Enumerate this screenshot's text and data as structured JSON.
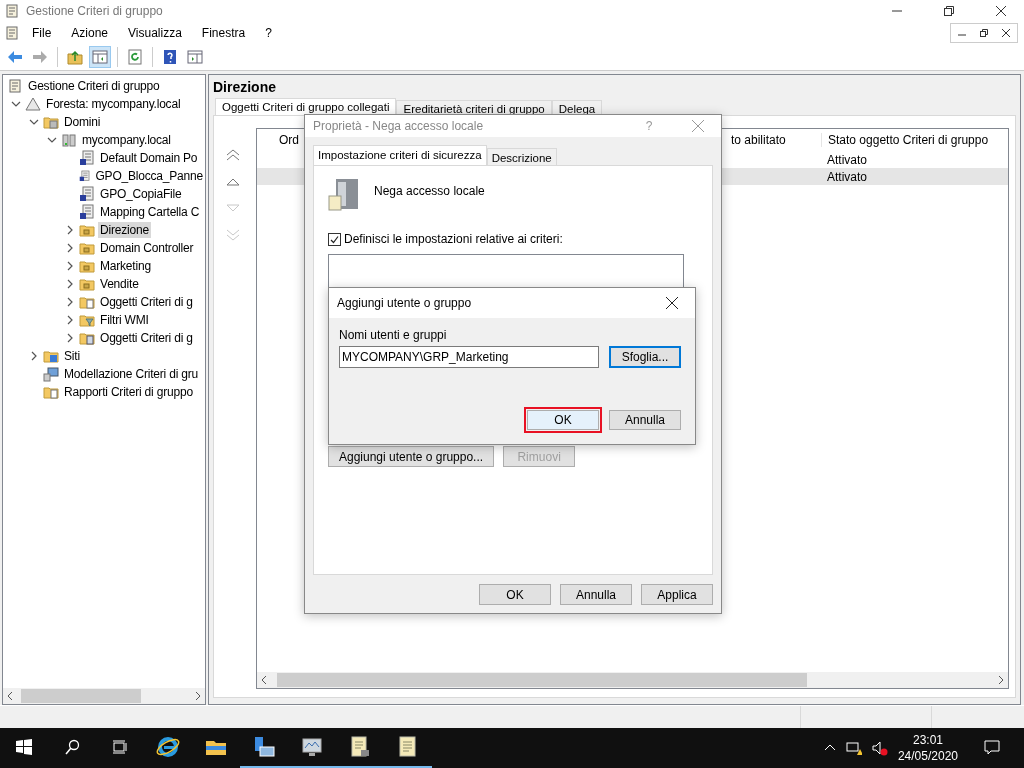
{
  "window": {
    "title": "Gestione Criteri di gruppo"
  },
  "menu": [
    "File",
    "Azione",
    "Visualizza",
    "Finestra",
    "?"
  ],
  "toolbar": [
    {
      "kind": "back",
      "disabled": false,
      "pressed": false
    },
    {
      "kind": "forward",
      "disabled": true,
      "pressed": false
    },
    {
      "kind": "up",
      "disabled": false,
      "pressed": false
    },
    {
      "kind": "pane",
      "disabled": false,
      "pressed": true
    },
    {
      "kind": "refresh",
      "disabled": false,
      "pressed": false
    },
    {
      "kind": "help",
      "disabled": false,
      "pressed": false
    },
    {
      "kind": "action-pane",
      "disabled": false,
      "pressed": false
    }
  ],
  "tree": [
    {
      "label": "Gestione Criteri di gruppo",
      "kind": "console",
      "selected": false,
      "children": [
        {
          "label": "Foresta: mycompany.local",
          "kind": "forest",
          "expanded": true,
          "selected": false,
          "children": [
            {
              "label": "Domini",
              "kind": "domains",
              "expanded": true,
              "selected": false,
              "children": [
                {
                  "label": "mycompany.local",
                  "kind": "domain",
                  "expanded": true,
                  "selected": false,
                  "children": [
                    {
                      "label": "Default Domain Po",
                      "kind": "gpo-link",
                      "selected": false
                    },
                    {
                      "label": "GPO_Blocca_Panne",
                      "kind": "gpo-link",
                      "selected": false
                    },
                    {
                      "label": "GPO_CopiaFile",
                      "kind": "gpo-link",
                      "selected": false
                    },
                    {
                      "label": "Mapping Cartella C",
                      "kind": "gpo-link",
                      "selected": false
                    },
                    {
                      "label": "Direzione",
                      "kind": "ou",
                      "expanded": false,
                      "selected": true
                    },
                    {
                      "label": "Domain Controller",
                      "kind": "ou",
                      "expanded": false,
                      "selected": false
                    },
                    {
                      "label": "Marketing",
                      "kind": "ou",
                      "expanded": false,
                      "selected": false
                    },
                    {
                      "label": "Vendite",
                      "kind": "ou",
                      "expanded": false,
                      "selected": false
                    },
                    {
                      "label": "Oggetti Criteri di g",
                      "kind": "gpo-folder",
                      "expanded": false,
                      "selected": false
                    },
                    {
                      "label": "Filtri WMI",
                      "kind": "wmi",
                      "expanded": false,
                      "selected": false
                    },
                    {
                      "label": "Oggetti Criteri di g",
                      "kind": "starter",
                      "expanded": false,
                      "selected": false
                    }
                  ]
                }
              ]
            },
            {
              "label": "Siti",
              "kind": "sites",
              "expanded": false,
              "selected": false
            },
            {
              "label": "Modellazione Criteri di gru",
              "kind": "modeling",
              "selected": false
            },
            {
              "label": "Rapporti Criteri di gruppo",
              "kind": "results",
              "selected": false
            }
          ]
        }
      ]
    }
  ],
  "details": {
    "title": "Direzione",
    "tabs": [
      {
        "label": "Oggetti Criteri di gruppo collegati",
        "selected": true
      },
      {
        "label": "Ereditarietà criteri di gruppo",
        "selected": false
      },
      {
        "label": "Delega",
        "selected": false
      }
    ],
    "order_buttons": [
      {
        "kind": "top",
        "disabled": false
      },
      {
        "kind": "up",
        "disabled": false
      },
      {
        "kind": "down",
        "disabled": true
      },
      {
        "kind": "bottom",
        "disabled": true
      }
    ],
    "table": {
      "columns": [
        "Ord",
        "to abilitato",
        "Stato oggetto Criteri di gruppo"
      ],
      "rows": [
        {
          "column_3": "Attivato",
          "selected": false
        },
        {
          "column_3": "Attivato",
          "selected": true
        }
      ]
    }
  },
  "properties_dialog": {
    "title": "Proprietà - Nega accesso locale",
    "help": "?",
    "tabs": [
      {
        "label": "Impostazione criteri di sicurezza",
        "selected": true
      },
      {
        "label": "Descrizione",
        "selected": false
      }
    ],
    "policy_name": "Nega accesso locale",
    "define": {
      "label": "Definisci le impostazioni relative ai criteri:",
      "checked": true
    },
    "list_buttons": [
      {
        "label": "Aggiungi utente o gruppo...",
        "disabled": false
      },
      {
        "label": "Rimuovi",
        "disabled": true
      }
    ],
    "footer_buttons": [
      "OK",
      "Annulla",
      "Applica"
    ]
  },
  "add_dialog": {
    "title": "Aggiungi utente o gruppo",
    "field_label": "Nomi utenti e gruppi",
    "field_value": "MYCOMPANY\\GRP_Marketing",
    "browse": {
      "label": "Sfoglia...",
      "focused": true
    },
    "buttons": [
      {
        "label": "OK",
        "highlighted": true
      },
      {
        "label": "Annulla",
        "highlighted": false
      }
    ]
  },
  "taskbar": {
    "apps": [
      {
        "kind": "ie",
        "running": false
      },
      {
        "kind": "explorer",
        "running": false
      },
      {
        "kind": "server-manager",
        "running": true
      },
      {
        "kind": "monitor",
        "running": true
      },
      {
        "kind": "gpm",
        "running": true
      },
      {
        "kind": "gpe",
        "running": true
      }
    ],
    "clock": {
      "time": "23:01",
      "date": "24/05/2020"
    }
  }
}
